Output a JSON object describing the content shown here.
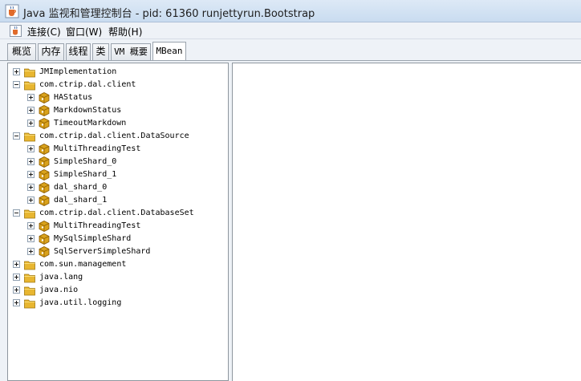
{
  "window": {
    "title": "Java 监视和管理控制台 - pid: 61360 runjettyrun.Bootstrap"
  },
  "menu": {
    "connect": "连接(C)",
    "window": "窗口(W)",
    "help": "帮助(H)"
  },
  "tabs": [
    "概览",
    "内存",
    "线程",
    "类",
    "VM 概要",
    "MBean"
  ],
  "tree": [
    {
      "label": "JMImplementation",
      "kind": "folder",
      "expanded": false
    },
    {
      "label": "com.ctrip.dal.client",
      "kind": "folder",
      "expanded": true
    },
    {
      "label": "HAStatus",
      "kind": "bean",
      "expanded": false
    },
    {
      "label": "MarkdownStatus",
      "kind": "bean",
      "expanded": false
    },
    {
      "label": "TimeoutMarkdown",
      "kind": "bean",
      "expanded": false
    },
    {
      "label": "com.ctrip.dal.client.DataSource",
      "kind": "folder",
      "expanded": true
    },
    {
      "label": "MultiThreadingTest",
      "kind": "bean",
      "expanded": false
    },
    {
      "label": "SimpleShard_0",
      "kind": "bean",
      "expanded": false
    },
    {
      "label": "SimpleShard_1",
      "kind": "bean",
      "expanded": false
    },
    {
      "label": "dal_shard_0",
      "kind": "bean",
      "expanded": false
    },
    {
      "label": "dal_shard_1",
      "kind": "bean",
      "expanded": false
    },
    {
      "label": "com.ctrip.dal.client.DatabaseSet",
      "kind": "folder",
      "expanded": true
    },
    {
      "label": "MultiThreadingTest",
      "kind": "bean",
      "expanded": false
    },
    {
      "label": "MySqlSimpleShard",
      "kind": "bean",
      "expanded": false
    },
    {
      "label": "SqlServerSimpleShard",
      "kind": "bean",
      "expanded": false
    },
    {
      "label": "com.sun.management",
      "kind": "folder",
      "expanded": false
    },
    {
      "label": "java.lang",
      "kind": "folder",
      "expanded": false
    },
    {
      "label": "java.nio",
      "kind": "folder",
      "expanded": false
    },
    {
      "label": "java.util.logging",
      "kind": "folder",
      "expanded": false
    }
  ],
  "colors": {
    "folder": "#e8b630",
    "bean": "#d9a21b",
    "titlebar": "#cfe0f3"
  }
}
